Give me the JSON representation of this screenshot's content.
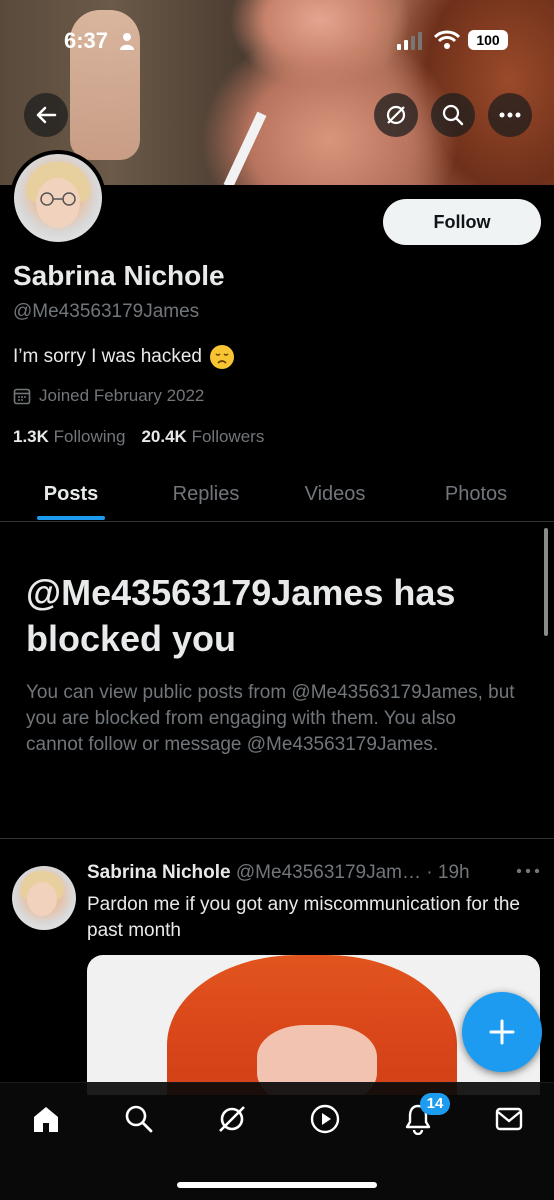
{
  "status_bar": {
    "time": "6:37",
    "battery": "100"
  },
  "profile": {
    "name": "Sabrina Nichole",
    "handle": "@Me43563179James",
    "bio": "I’m sorry I was hacked",
    "joined": "Joined February 2022",
    "following_count": "1.3K",
    "following_label": "Following",
    "followers_count": "20.4K",
    "followers_label": "Followers",
    "follow_button": "Follow"
  },
  "tabs": [
    {
      "label": "Posts",
      "active": true
    },
    {
      "label": "Replies",
      "active": false
    },
    {
      "label": "Videos",
      "active": false
    },
    {
      "label": "Photos",
      "active": false
    }
  ],
  "blocked_notice": {
    "title": "@Me43563179James has blocked you",
    "text": "You can view public posts from @Me43563179James, but you are blocked from engaging with them. You also cannot follow or message @Me43563179James."
  },
  "post": {
    "author": "Sabrina Nichole",
    "handle": "@Me43563179Jam…",
    "time": "· 19h",
    "text": "Pardon  me if you got  any miscommunication for the past month"
  },
  "bottom_nav": {
    "notifications_badge": "14"
  },
  "icons": {
    "header": [
      "back-arrow-icon",
      "grok-icon",
      "search-icon",
      "more-icon"
    ],
    "nav": [
      "home-icon",
      "search-icon",
      "grok-icon",
      "video-icon",
      "notifications-icon",
      "messages-icon"
    ]
  },
  "colors": {
    "accent": "#1d9bf0",
    "background": "#000000",
    "muted": "#71767b"
  }
}
